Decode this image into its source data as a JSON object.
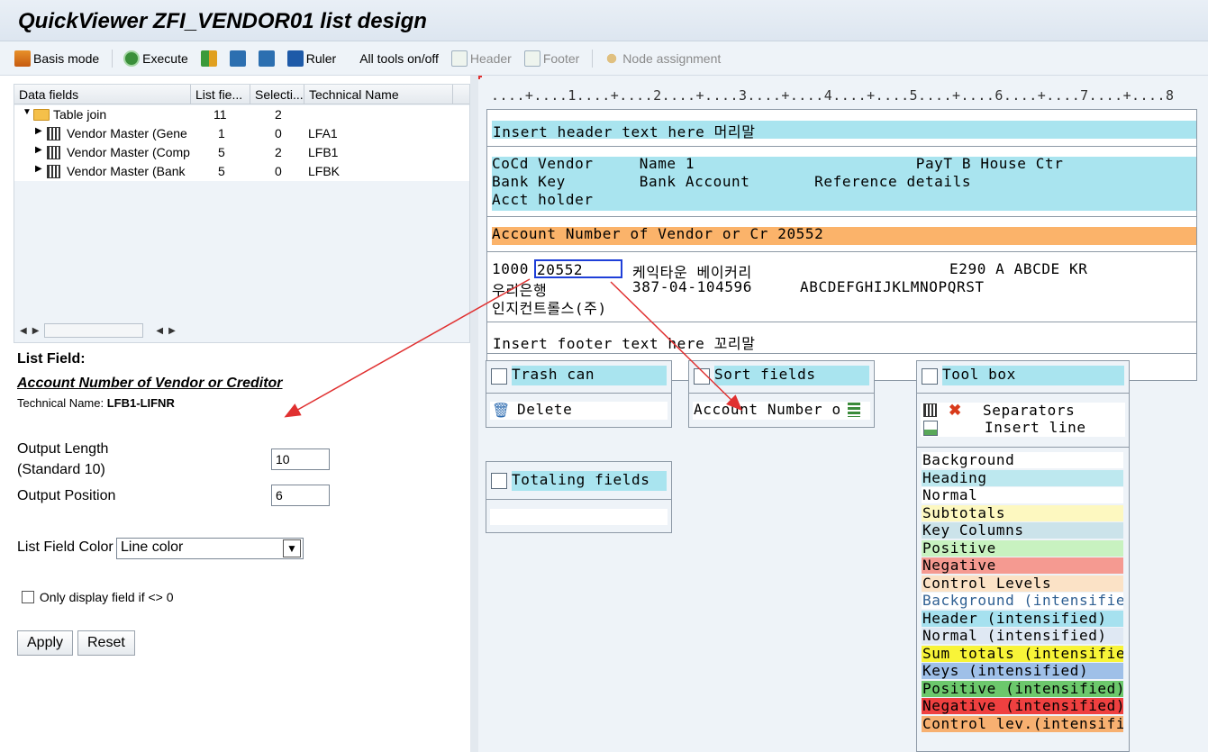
{
  "title": "QuickViewer ZFI_VENDOR01 list design",
  "toolbar": {
    "basis_mode": "Basis mode",
    "execute": "Execute",
    "ruler": "Ruler",
    "all_tools": "All tools on/off",
    "header": "Header",
    "footer": "Footer",
    "node_assignment": "Node assignment"
  },
  "tree": {
    "columns": [
      "Data fields",
      "List fie...",
      "Selecti...",
      "Technical Name"
    ],
    "rows": [
      {
        "name": "Table join",
        "list": "11",
        "sel": "2",
        "tech": ""
      },
      {
        "name": "Vendor Master (Gene",
        "list": "1",
        "sel": "0",
        "tech": "LFA1"
      },
      {
        "name": "Vendor Master (Comp",
        "list": "5",
        "sel": "2",
        "tech": "LFB1"
      },
      {
        "name": "Vendor Master (Bank",
        "list": "5",
        "sel": "0",
        "tech": "LFBK"
      }
    ]
  },
  "props": {
    "heading": "List Field:",
    "field_name": "Account Number of Vendor or Creditor",
    "tech_prefix": "Technical Name:",
    "tech_name": "LFB1-LIFNR",
    "output_length_label1": "Output Length",
    "output_length_label2": "(Standard 10)",
    "output_length": "10",
    "output_position_label": "Output Position",
    "output_position": "6",
    "color_label": "List Field Color",
    "color_value": "Line color",
    "only_display": "Only display field if <> 0",
    "apply": "Apply",
    "reset": "Reset"
  },
  "ruler": "....+....1....+....2....+....3....+....4....+....5....+....6....+....7....+....8",
  "layout": {
    "header_text": "Insert header text here 머리말",
    "col_line1": "CoCd Vendor     Name 1                        PayT B House Ctr",
    "col_line2": "Bank Key        Bank Account       Reference details",
    "col_line3": "Acct holder",
    "selected_field": "Account Number of Vendor or Cr 20552",
    "data_cocd": "1000",
    "data_vendor": "20552",
    "data_rest": "케익타운 베이커리",
    "data_tail": "E290 A ABCDE KR",
    "data_line2a": "우리은행",
    "data_line2b": "387-04-104596",
    "data_line2c": "ABCDEFGHIJKLMNOPQRST",
    "data_line3": "인지컨트롤스(주)",
    "footer_text": "Insert footer text here 꼬리말"
  },
  "tiles": {
    "trash": "Trash can",
    "delete": "Delete",
    "sort": "Sort fields",
    "sort_item": "Account Number o",
    "toolbox": "Tool box",
    "separators": "Separators",
    "insert_line": "Insert line",
    "totaling": "Totaling fields"
  },
  "colors": [
    {
      "label": "Background",
      "color": "#ffffff",
      "text": "#000000"
    },
    {
      "label": "Heading",
      "color": "#bde8ef",
      "text": "#000000"
    },
    {
      "label": "Normal",
      "color": "#ffffff",
      "text": "#000000"
    },
    {
      "label": "Subtotals",
      "color": "#fdf8c0",
      "text": "#000000"
    },
    {
      "label": "Key Columns",
      "color": "#cbe3ea",
      "text": "#000000"
    },
    {
      "label": "Positive",
      "color": "#c8f2c0",
      "text": "#000000"
    },
    {
      "label": "Negative",
      "color": "#f59a91",
      "text": "#000000"
    },
    {
      "label": "Control Levels",
      "color": "#fbe2c6",
      "text": "#000000"
    },
    {
      "label": "Background (intensified",
      "color": "#ffffff",
      "text": "#2e5f92"
    },
    {
      "label": "Header (intensified)",
      "color": "#a6e1ef",
      "text": "#000000"
    },
    {
      "label": "Normal (intensified)",
      "color": "#dfe8f3",
      "text": "#000000"
    },
    {
      "label": "Sum totals (intensified",
      "color": "#f8f438",
      "text": "#000000"
    },
    {
      "label": "Keys (intensified)",
      "color": "#9fc0e8",
      "text": "#000000"
    },
    {
      "label": "Positive (intensified)",
      "color": "#6cc86c",
      "text": "#000000"
    },
    {
      "label": "Negative (intensified)",
      "color": "#ef4040",
      "text": "#000000"
    },
    {
      "label": "Control lev.(intensifie",
      "color": "#f7b071",
      "text": "#000000"
    }
  ],
  "accent": {
    "arrow": "#e03030",
    "selection": "#1f3fd8"
  }
}
